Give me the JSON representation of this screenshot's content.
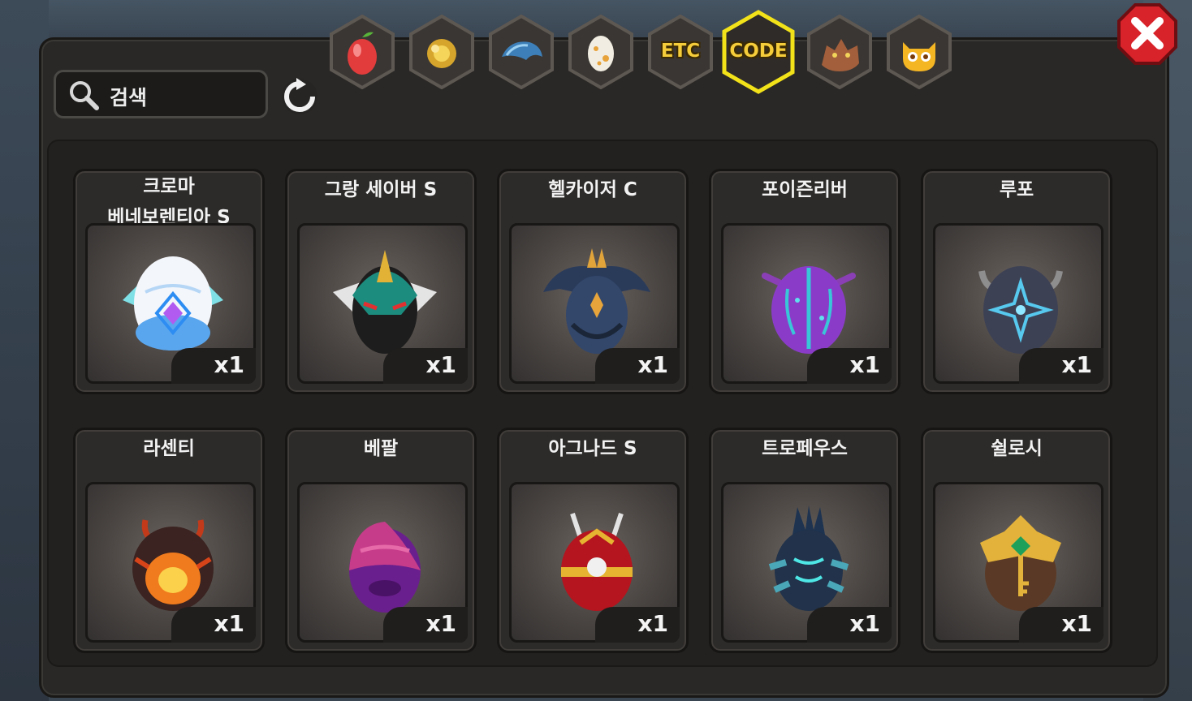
{
  "search": {
    "placeholder": "검색"
  },
  "tabs": [
    {
      "name": "fruit-tab-icon",
      "label": ""
    },
    {
      "name": "gold-tab-icon",
      "label": ""
    },
    {
      "name": "dragon-scale-tab-icon",
      "label": ""
    },
    {
      "name": "egg-tab-icon",
      "label": ""
    },
    {
      "name": "etc-tab",
      "label": "ETC"
    },
    {
      "name": "code-tab",
      "label": "CODE",
      "active": true
    },
    {
      "name": "dragon-tab-icon",
      "label": ""
    },
    {
      "name": "monster-tab-icon",
      "label": ""
    }
  ],
  "items": [
    {
      "name": "크로마\n베네보렌티아 S",
      "qty": "x1",
      "icon": "chroma-egg"
    },
    {
      "name": "그랑 세이버 S",
      "qty": "x1",
      "icon": "grand-saber-egg"
    },
    {
      "name": "헬카이저 C",
      "qty": "x1",
      "icon": "hellkaiser-egg"
    },
    {
      "name": "포이즌리버",
      "qty": "x1",
      "icon": "poison-river-egg"
    },
    {
      "name": "루포",
      "qty": "x1",
      "icon": "lupo-egg"
    },
    {
      "name": "라센티",
      "qty": "x1",
      "icon": "lasenti-egg"
    },
    {
      "name": "베팔",
      "qty": "x1",
      "icon": "bepal-egg"
    },
    {
      "name": "아그나드 S",
      "qty": "x1",
      "icon": "agnad-egg"
    },
    {
      "name": "트로페우스",
      "qty": "x1",
      "icon": "tropeus-egg"
    },
    {
      "name": "쉴로시",
      "qty": "x1",
      "icon": "shilosi-egg"
    }
  ],
  "colors": {
    "active_tab": "#f2e21a",
    "close": "#d9232a"
  }
}
